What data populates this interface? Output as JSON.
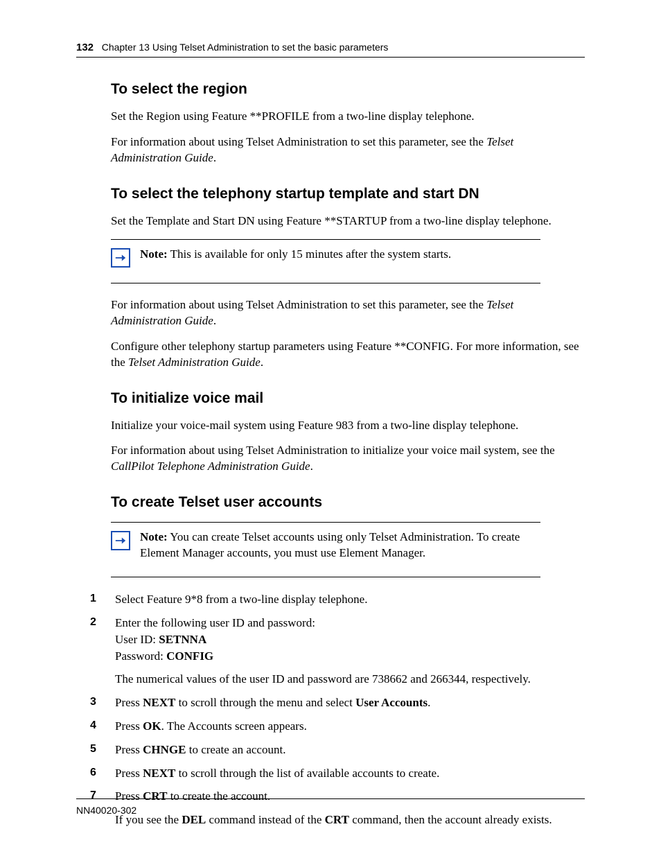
{
  "header": {
    "page_num": "132",
    "chapter": "Chapter 13  Using Telset Administration to set the basic parameters"
  },
  "sections": {
    "region": {
      "heading": "To select the region",
      "p1": "Set the Region using Feature **PROFILE from a two-line display telephone.",
      "p2a": "For information about using Telset Administration to set this parameter, see the ",
      "p2b": "Telset Administration Guide",
      "p2c": "."
    },
    "template": {
      "heading": "To select the telephony startup template and start DN",
      "p1": "Set the Template and Start DN using Feature **STARTUP from a two-line display telephone.",
      "note_label": "Note:",
      "note_text": " This is available for only 15 minutes after the system starts.",
      "p2a": "For information about using Telset Administration to set this parameter, see the ",
      "p2b": "Telset Administration Guide",
      "p2c": ".",
      "p3a": "Configure other telephony startup parameters using Feature **CONFIG. For more information, see the ",
      "p3b": "Telset Administration Guide",
      "p3c": "."
    },
    "vmail": {
      "heading": "To initialize voice mail",
      "p1": "Initialize your voice-mail system using Feature 983 from a two-line display telephone.",
      "p2a": "For information about using Telset Administration to initialize your voice mail system, see the ",
      "p2b": "CallPilot Telephone Administration Guide",
      "p2c": "."
    },
    "accounts": {
      "heading": "To create Telset user accounts",
      "note_label": "Note:",
      "note_text": " You can create Telset accounts using only Telset Administration. To create Element Manager accounts, you must use Element Manager.",
      "steps": [
        {
          "n": "1",
          "t": "Select Feature 9*8 from a two-line display telephone."
        },
        {
          "n": "2",
          "t1": "Enter the following user ID and password:",
          "uid_label": "User ID: ",
          "uid": "SETNNA",
          "pw_label": "Password: ",
          "pw": "CONFIG",
          "t2": "The numerical values of the user ID and password are 738662 and 266344, respectively."
        },
        {
          "n": "3",
          "pre": "Press ",
          "b1": "NEXT",
          "mid": " to scroll through the menu and select ",
          "b2": "User Accounts",
          "post": "."
        },
        {
          "n": "4",
          "pre": "Press ",
          "b1": "OK",
          "post": ". The Accounts screen appears."
        },
        {
          "n": "5",
          "pre": "Press ",
          "b1": "CHNGE",
          "post": " to create an account."
        },
        {
          "n": "6",
          "pre": "Press ",
          "b1": "NEXT",
          "post": " to scroll through the list of available accounts to create."
        },
        {
          "n": "7",
          "pre": "Press ",
          "b1": "CRT",
          "post": " to create the account.",
          "sub_pre": "If you see the ",
          "sub_b1": "DEL",
          "sub_mid": " command instead of the ",
          "sub_b2": "CRT",
          "sub_post": " command, then the account already exists."
        }
      ]
    }
  },
  "footer": "NN40020-302"
}
